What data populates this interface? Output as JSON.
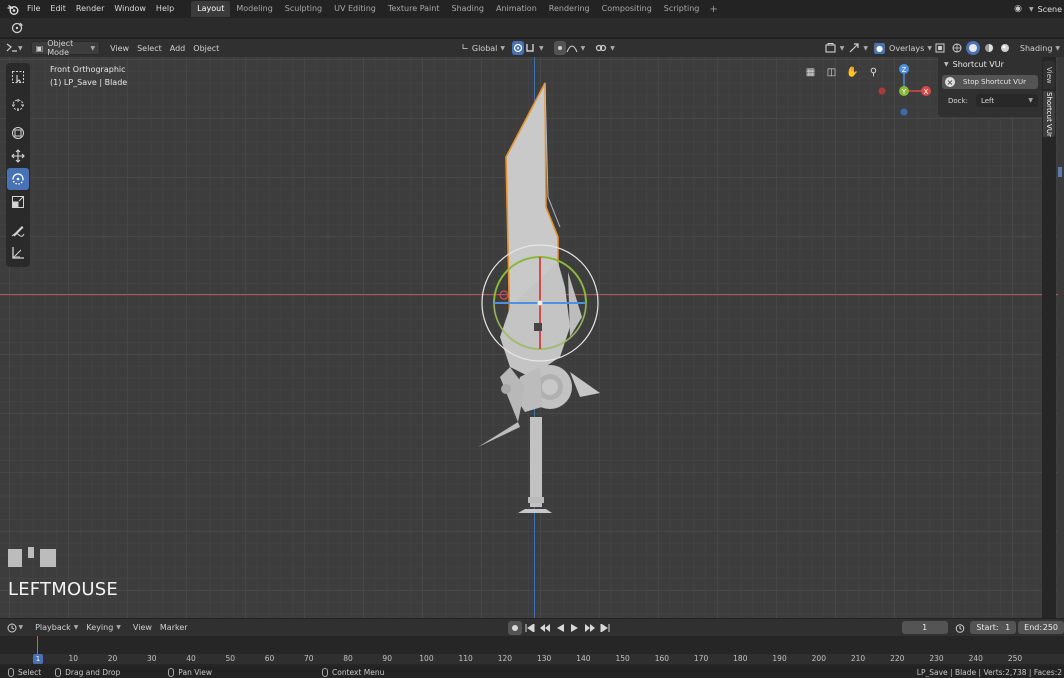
{
  "menubar": {
    "menus": [
      "File",
      "Edit",
      "Render",
      "Window",
      "Help"
    ],
    "workspaces": [
      {
        "label": "Layout",
        "active": true
      },
      {
        "label": "Modeling",
        "active": false
      },
      {
        "label": "Sculpting",
        "active": false
      },
      {
        "label": "UV Editing",
        "active": false
      },
      {
        "label": "Texture Paint",
        "active": false
      },
      {
        "label": "Shading",
        "active": false
      },
      {
        "label": "Animation",
        "active": false
      },
      {
        "label": "Rendering",
        "active": false
      },
      {
        "label": "Compositing",
        "active": false
      },
      {
        "label": "Scripting",
        "active": false
      }
    ],
    "add_tab": "+",
    "scene": "Scene"
  },
  "viewport_header": {
    "mode": "Object Mode",
    "menus": [
      "View",
      "Select",
      "Add",
      "Object"
    ],
    "orientation": "Global",
    "overlays": "Overlays",
    "shading": "Shading"
  },
  "viewport": {
    "view_name": "Front Orthographic",
    "object_info": "(1) LP_Save | Blade"
  },
  "gizmo": {
    "z": "Z",
    "x": "X",
    "y": "Y"
  },
  "npanel": {
    "title": "Shortcut VUr",
    "stop_button": "Stop Shortcut VUr",
    "dock_label": "Dock:",
    "dock_value": "Left",
    "tabs": [
      "View",
      "Shortcut VUr"
    ]
  },
  "screencast": {
    "key": "LEFTMOUSE"
  },
  "timeline": {
    "menus": [
      "Playback",
      "Keying",
      "View",
      "Marker"
    ],
    "current_frame": "1",
    "start_label": "Start:",
    "start_value": "1",
    "end_label": "End:",
    "end_value": "250",
    "ticks": [
      "1",
      "10",
      "20",
      "30",
      "40",
      "50",
      "60",
      "70",
      "80",
      "90",
      "100",
      "110",
      "120",
      "130",
      "140",
      "150",
      "160",
      "170",
      "180",
      "190",
      "200",
      "210",
      "220",
      "230",
      "240",
      "250"
    ]
  },
  "statusbar": {
    "select": "Select",
    "drag": "Drag and Drop",
    "pan": "Pan View",
    "context": "Context Menu",
    "stats": "LP_Save | Blade | Verts:2,738 | Faces:2"
  },
  "colors": {
    "accent": "#4772b3",
    "selection_outline": "#e8902a",
    "axis_x": "#b55454",
    "axis_z": "#3f6fb3"
  }
}
